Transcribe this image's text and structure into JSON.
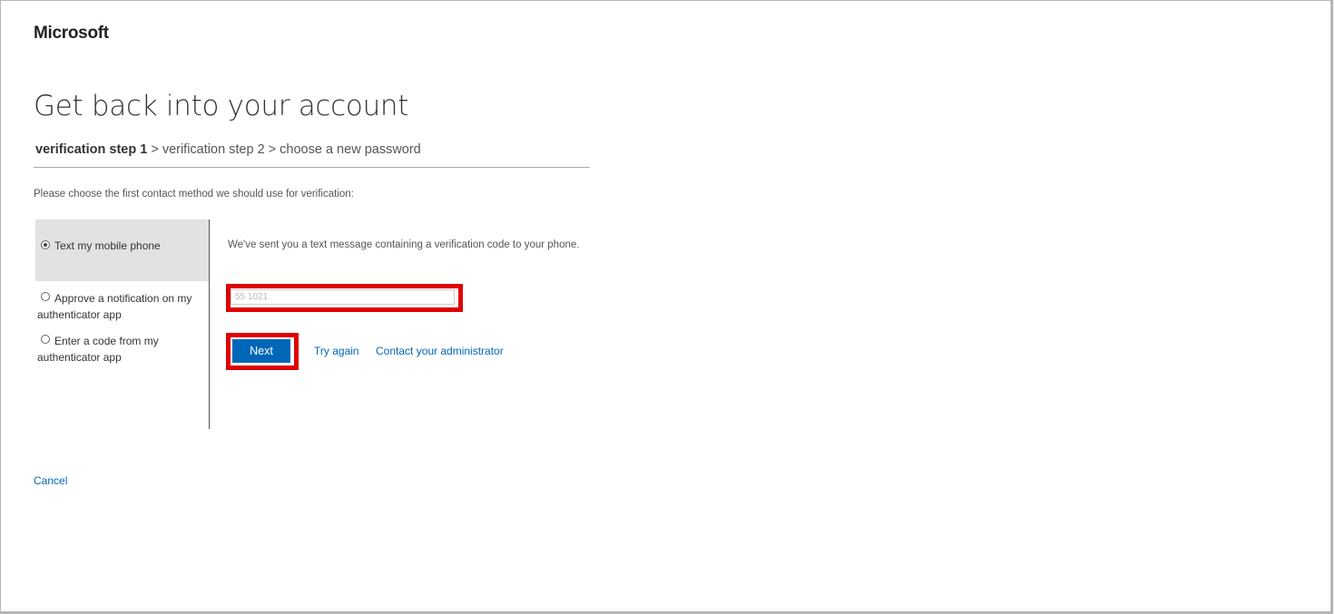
{
  "brand": {
    "logo_text": "Microsoft"
  },
  "page": {
    "title": "Get back into your account"
  },
  "breadcrumb": {
    "current": "verification step 1",
    "rest": " > verification step 2 > choose a new password"
  },
  "instruction": "Please choose the first contact method we should use for verification:",
  "methods": [
    {
      "label": "Text my mobile phone",
      "selected": true
    },
    {
      "label": "Approve a notification on my authenticator app",
      "selected": false
    },
    {
      "label": "Enter a code from my authenticator app",
      "selected": false
    }
  ],
  "verification": {
    "sent_message": "We've sent you a text message containing a verification code to your phone.",
    "code_value": "55 1021"
  },
  "actions": {
    "next_label": "Next",
    "try_again_label": "Try again",
    "contact_admin_label": "Contact your administrator",
    "cancel_label": "Cancel"
  },
  "colors": {
    "accent": "#0067b8",
    "highlight": "#e00000",
    "selected_bg": "#e2e2e2"
  }
}
